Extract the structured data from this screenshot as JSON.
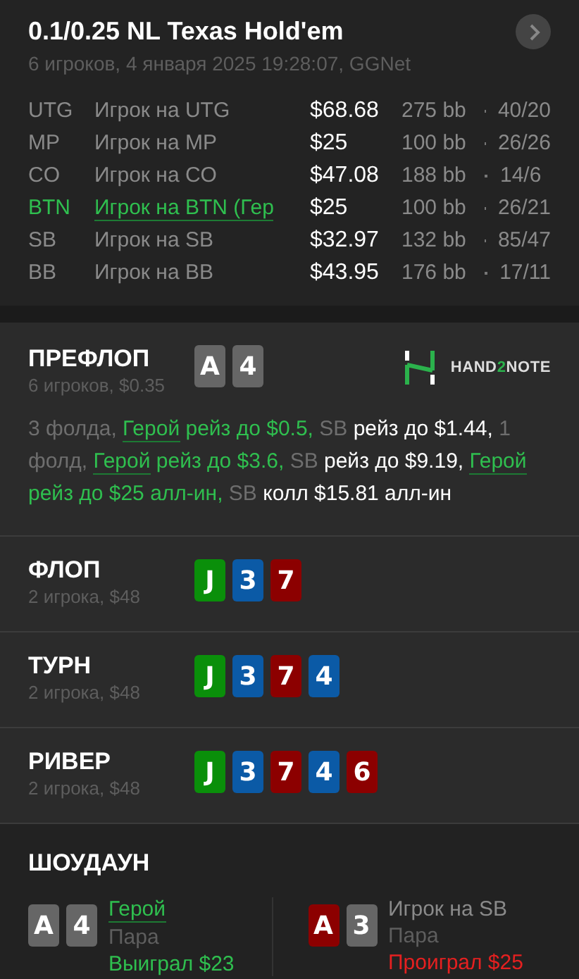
{
  "header": {
    "title": "0.1/0.25 NL Texas Hold'em",
    "subtitle": "6 игроков, 4 января 2025 19:28:07, GGNet"
  },
  "players": [
    {
      "position": "UTG",
      "name": "Игрок на UTG",
      "stack": "$68.68",
      "bb": "275 bb",
      "stats": "40/20",
      "hero": false
    },
    {
      "position": "MP",
      "name": "Игрок на MP",
      "stack": "$25",
      "bb": "100 bb",
      "stats": "26/26",
      "hero": false
    },
    {
      "position": "CO",
      "name": "Игрок на CO",
      "stack": "$47.08",
      "bb": "188 bb",
      "stats": "14/6",
      "hero": false
    },
    {
      "position": "BTN",
      "name": "Игрок на BTN (Гер",
      "stack": "$25",
      "bb": "100 bb",
      "stats": "26/21",
      "hero": true
    },
    {
      "position": "SB",
      "name": "Игрок на SB",
      "stack": "$32.97",
      "bb": "132 bb",
      "stats": "85/47",
      "hero": false
    },
    {
      "position": "BB",
      "name": "Игрок на BB",
      "stack": "$43.95",
      "bb": "176 bb",
      "stats": "17/11",
      "hero": false
    }
  ],
  "preflop": {
    "title": "ПРЕФЛОП",
    "subtitle": "6 игроков, $0.35",
    "cards": [
      {
        "rank": "A",
        "color": "#666666"
      },
      {
        "rank": "4",
        "color": "#666666"
      }
    ],
    "logo": [
      {
        "text": "HAND",
        "kind": "plain"
      },
      {
        "text": "2",
        "kind": "accent"
      },
      {
        "text": "NOTE",
        "kind": "plain"
      }
    ],
    "actions": [
      {
        "text": "3 фолда, ",
        "kind": "muted"
      },
      {
        "text": "Герой",
        "kind": "hero_name"
      },
      {
        "text": " рейз до $0.5, ",
        "kind": "hero"
      },
      {
        "text": "SB ",
        "kind": "muted"
      },
      {
        "text": "рейз до $1.44, ",
        "kind": "action"
      },
      {
        "text": "1 фолд, ",
        "kind": "muted"
      },
      {
        "text": "Герой",
        "kind": "hero_name"
      },
      {
        "text": " рейз до $3.6, ",
        "kind": "hero"
      },
      {
        "text": "SB ",
        "kind": "muted"
      },
      {
        "text": "рейз до $9.19, ",
        "kind": "action"
      },
      {
        "text": "Герой",
        "kind": "hero_name"
      },
      {
        "text": " рейз до $25 алл-ин, ",
        "kind": "hero"
      },
      {
        "text": "SB ",
        "kind": "muted"
      },
      {
        "text": "колл $15.81 алл-ин",
        "kind": "action"
      }
    ]
  },
  "streets": [
    {
      "title": "ФЛОП",
      "subtitle": "2 игрока, $48",
      "cards": [
        {
          "rank": "J",
          "color": "#0a8f0a"
        },
        {
          "rank": "3",
          "color": "#0b5aa6"
        },
        {
          "rank": "7",
          "color": "#8c0000"
        }
      ]
    },
    {
      "title": "ТУРН",
      "subtitle": "2 игрока, $48",
      "cards": [
        {
          "rank": "J",
          "color": "#0a8f0a"
        },
        {
          "rank": "3",
          "color": "#0b5aa6"
        },
        {
          "rank": "7",
          "color": "#8c0000"
        },
        {
          "rank": "4",
          "color": "#0b5aa6"
        }
      ]
    },
    {
      "title": "РИВЕР",
      "subtitle": "2 игрока, $48",
      "cards": [
        {
          "rank": "J",
          "color": "#0a8f0a"
        },
        {
          "rank": "3",
          "color": "#0b5aa6"
        },
        {
          "rank": "7",
          "color": "#8c0000"
        },
        {
          "rank": "4",
          "color": "#0b5aa6"
        },
        {
          "rank": "6",
          "color": "#8c0000"
        }
      ]
    }
  ],
  "showdown": {
    "title": "ШОУДАУН",
    "players": [
      {
        "name": "Герой",
        "hand": "Пара",
        "result": "Выиграл $23",
        "won": true,
        "hero": true,
        "cards": [
          {
            "rank": "A",
            "color": "#666666"
          },
          {
            "rank": "4",
            "color": "#666666"
          }
        ]
      },
      {
        "name": "Игрок на SB",
        "hand": "Пара",
        "result": "Проиграл $25",
        "won": false,
        "hero": false,
        "cards": [
          {
            "rank": "A",
            "color": "#8c0000"
          },
          {
            "rank": "3",
            "color": "#666666"
          }
        ]
      }
    ]
  }
}
